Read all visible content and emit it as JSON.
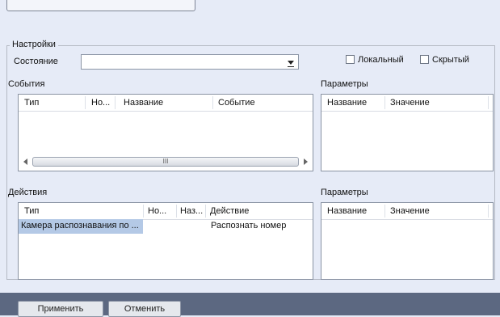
{
  "settings": {
    "group_title": "Настройки",
    "state_label": "Состояние",
    "state_value": "",
    "local_label": "Локальный",
    "hidden_label": "Скрытый"
  },
  "events": {
    "title": "События",
    "columns": [
      "Тип",
      "Но...",
      "Название",
      "Событие"
    ],
    "rows": [],
    "hscroll_grip": "III"
  },
  "events_params": {
    "title": "Параметры",
    "columns": [
      "Название",
      "Значение"
    ]
  },
  "actions": {
    "title": "Действия",
    "columns": [
      "Тип",
      "Но...",
      "Наз...",
      "Действие"
    ],
    "rows": [
      {
        "type": "Камера распознавания по ...",
        "number": "",
        "name": "",
        "action": "Распознать номер"
      }
    ]
  },
  "actions_params": {
    "title": "Параметры",
    "columns": [
      "Название",
      "Значение"
    ]
  },
  "footer": {
    "apply_label": "Применить",
    "cancel_label": "Отменить"
  },
  "colors": {
    "background": "#e6ebf7",
    "selection": "#b4c9e6",
    "bottom_bar": "#5c6881"
  }
}
